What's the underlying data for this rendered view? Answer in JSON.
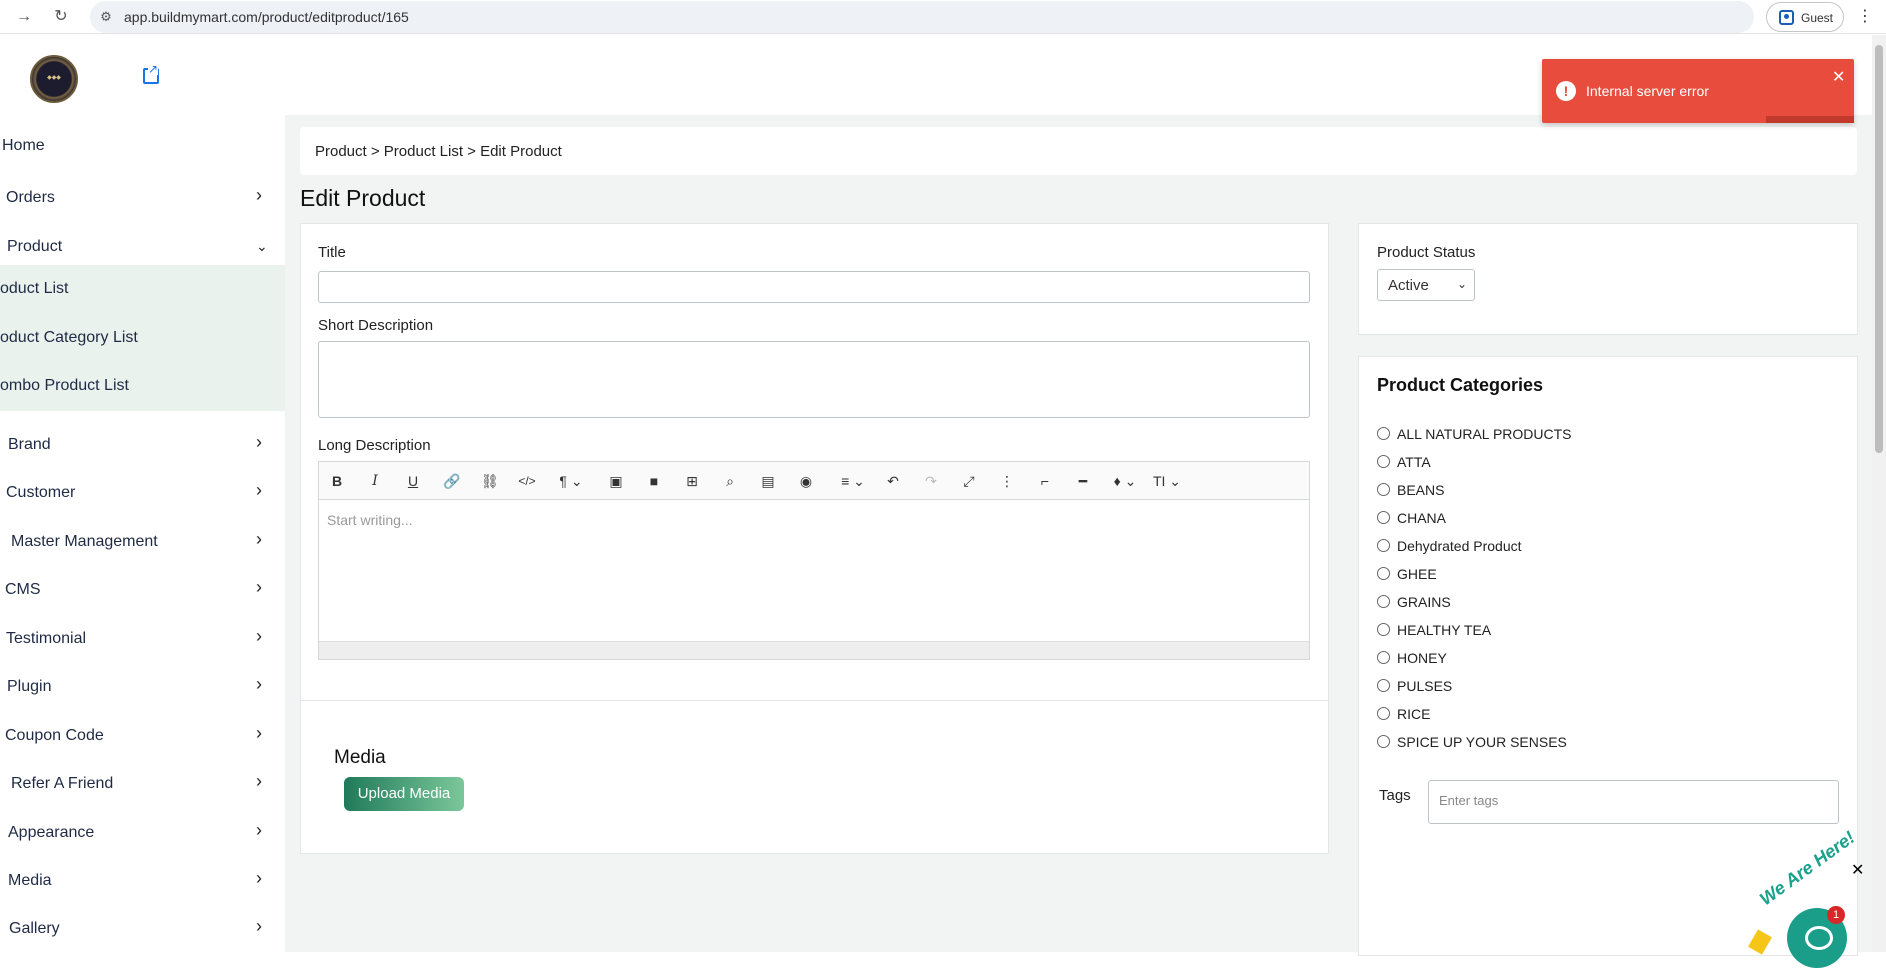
{
  "browser": {
    "url": "app.buildmymart.com/product/editproduct/165",
    "profile": "Guest"
  },
  "sidebar": {
    "items": [
      {
        "label": "Home"
      },
      {
        "label": "Orders"
      },
      {
        "label": "Product"
      },
      {
        "label": "Brand"
      },
      {
        "label": "Customer"
      },
      {
        "label": "Master Management"
      },
      {
        "label": "CMS"
      },
      {
        "label": "Testimonial"
      },
      {
        "label": "Plugin"
      },
      {
        "label": "Coupon Code"
      },
      {
        "label": "Refer A Friend"
      },
      {
        "label": "Appearance"
      },
      {
        "label": "Media"
      },
      {
        "label": "Gallery"
      }
    ],
    "product_sub": [
      {
        "label": "oduct List"
      },
      {
        "label": "oduct Category List"
      },
      {
        "label": "ombo Product List"
      }
    ]
  },
  "breadcrumb": "Product > Product List > Edit Product",
  "page_title": "Edit Product",
  "form": {
    "title_label": "Title",
    "title_value": "",
    "short_desc_label": "Short Description",
    "long_desc_label": "Long Description",
    "editor_placeholder": "Start writing..."
  },
  "media": {
    "heading": "Media",
    "upload_label": "Upload Media"
  },
  "status": {
    "label": "Product Status",
    "value": "Active"
  },
  "categories": {
    "heading": "Product Categories",
    "options": [
      "ALL NATURAL PRODUCTS",
      "ATTA",
      "BEANS",
      "CHANA",
      "Dehydrated Product",
      "GHEE",
      "GRAINS",
      "HEALTHY TEA",
      "HONEY",
      "PULSES",
      "RICE",
      "SPICE UP YOUR SENSES"
    ]
  },
  "tags": {
    "label": "Tags",
    "placeholder": "Enter tags"
  },
  "toast": {
    "message": "Internal server error"
  },
  "chat": {
    "text": "We Are Here!",
    "badge": "1"
  }
}
